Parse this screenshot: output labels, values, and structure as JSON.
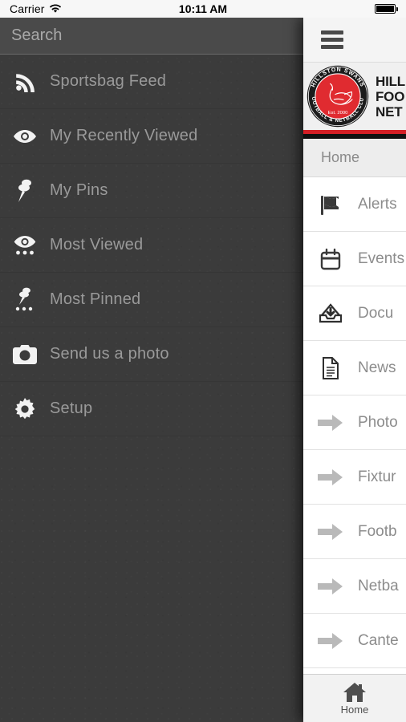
{
  "status_bar": {
    "carrier": "Carrier",
    "wifi_icon": "wifi-icon",
    "time": "10:11 AM",
    "battery_icon": "battery-full-icon"
  },
  "drawer": {
    "search": {
      "placeholder": "Search",
      "value": ""
    },
    "items": [
      {
        "label": "Sportsbag Feed",
        "icon": "rss-icon"
      },
      {
        "label": "My Recently Viewed",
        "icon": "eye-icon"
      },
      {
        "label": "My Pins",
        "icon": "pin-icon"
      },
      {
        "label": "Most Viewed",
        "icon": "eye-dots-icon"
      },
      {
        "label": "Most Pinned",
        "icon": "pin-dots-icon"
      },
      {
        "label": "Send us a photo",
        "icon": "camera-icon"
      },
      {
        "label": "Setup",
        "icon": "gear-icon"
      }
    ]
  },
  "content": {
    "menu_button": "hamburger-icon",
    "brand": {
      "logo_ring_top": "HILLSTON SWANS",
      "logo_ring_bottom": "FOOTBALL & NETBALL CLUB",
      "logo_est": "Est. 2000",
      "title_line1": "HILL",
      "title_line2": "FOO",
      "title_line3": "NET",
      "stripe_red": "#d41f26",
      "stripe_black": "#111111",
      "logo_red": "#e02b30"
    },
    "section_title": "Home",
    "rows": [
      {
        "label": "Alerts",
        "icon": "flag-icon"
      },
      {
        "label": "Events",
        "icon": "calendar-icon"
      },
      {
        "label": "Docu",
        "icon": "inbox-download-icon"
      },
      {
        "label": "News",
        "icon": "document-icon"
      },
      {
        "label": "Photo",
        "icon": "arrow-right-icon"
      },
      {
        "label": "Fixtur",
        "icon": "arrow-right-icon"
      },
      {
        "label": "Footb",
        "icon": "arrow-right-icon"
      },
      {
        "label": "Netba",
        "icon": "arrow-right-icon"
      },
      {
        "label": "Cante",
        "icon": "arrow-right-icon"
      }
    ],
    "tabbar": {
      "tabs": [
        {
          "label": "Home",
          "icon": "home-icon"
        }
      ]
    }
  }
}
